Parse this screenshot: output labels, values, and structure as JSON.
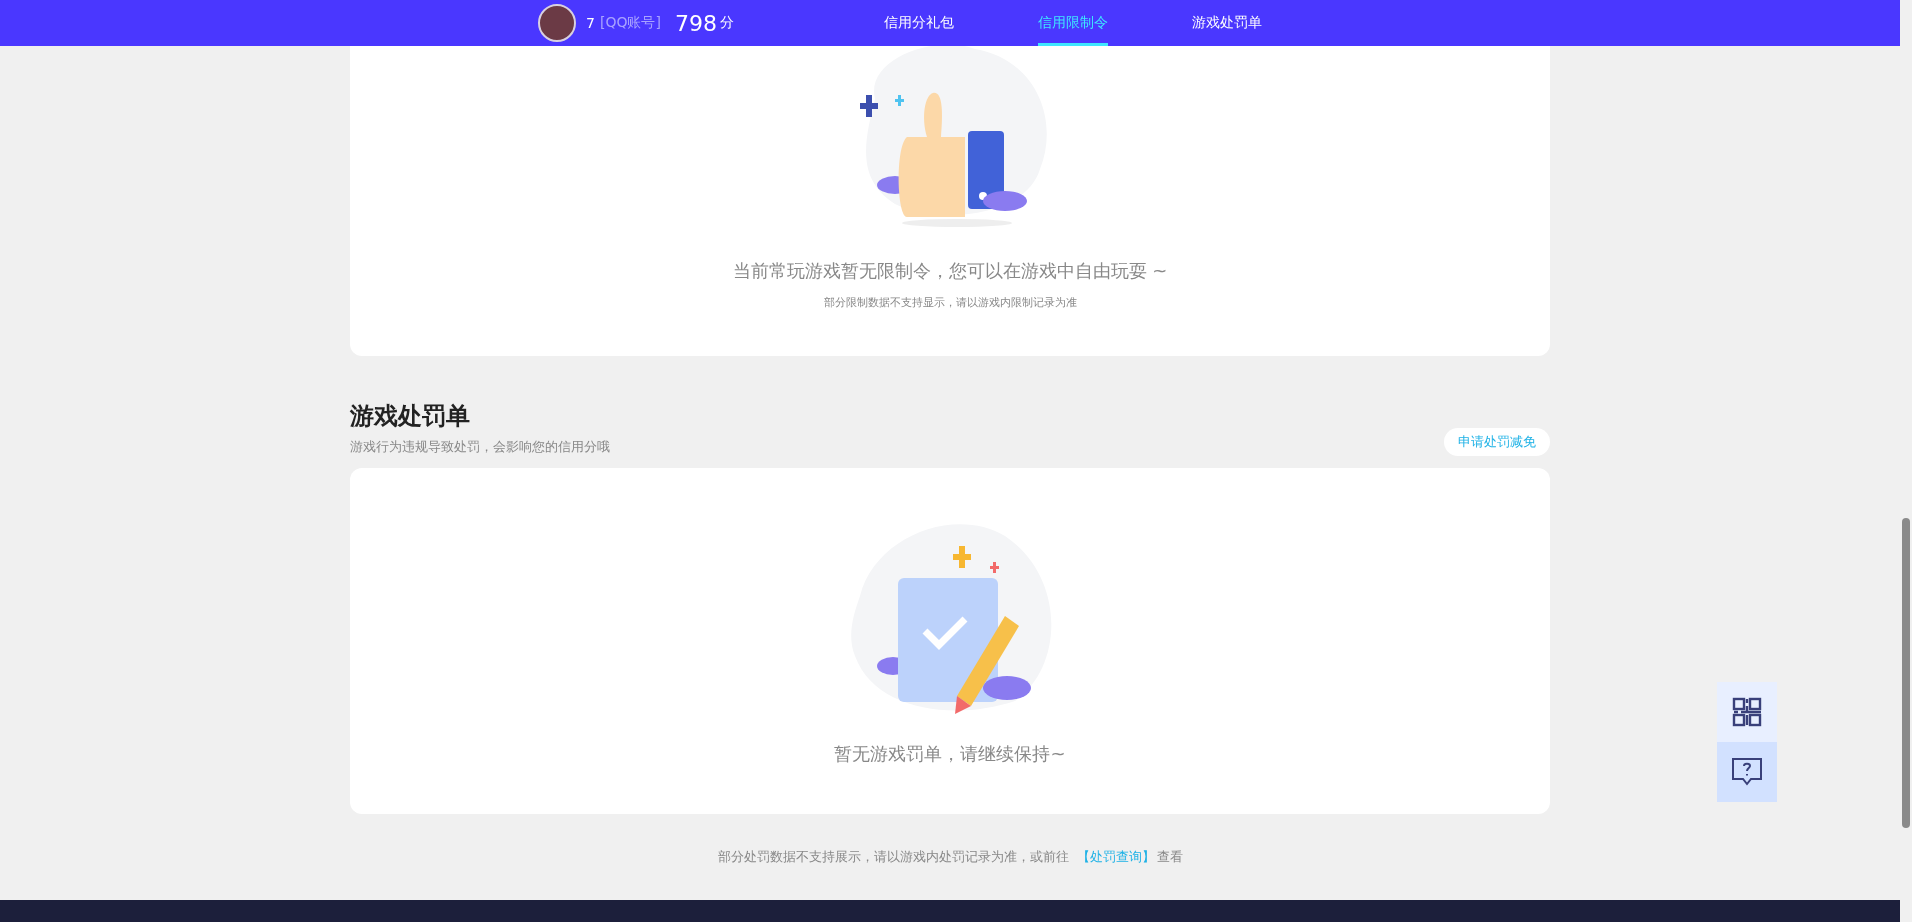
{
  "header": {
    "user": {
      "name": "7",
      "account_type": "[QQ账号]",
      "score": "798",
      "score_unit": "分"
    },
    "tabs": [
      {
        "label": "信用分礼包",
        "selected": false
      },
      {
        "label": "信用限制令",
        "selected": true
      },
      {
        "label": "游戏处罚单",
        "selected": false
      }
    ]
  },
  "restrictions_card": {
    "message": "当前常玩游戏暂无限制令，您可以在游戏中自由玩耍 ~",
    "note": "部分限制数据不支持显示，请以游戏内限制记录为准"
  },
  "penalties": {
    "title": "游戏处罚单",
    "subtitle": "游戏行为违规导致处罚，会影响您的信用分哦",
    "appeal_button": "申请处罚减免",
    "empty_message": "暂无游戏罚单，请继续保持~"
  },
  "footer_note": {
    "text_before": "部分处罚数据不支持展示，请以游戏内处罚记录为准，或前往",
    "link": "【处罚查询】",
    "text_after": "查看"
  }
}
